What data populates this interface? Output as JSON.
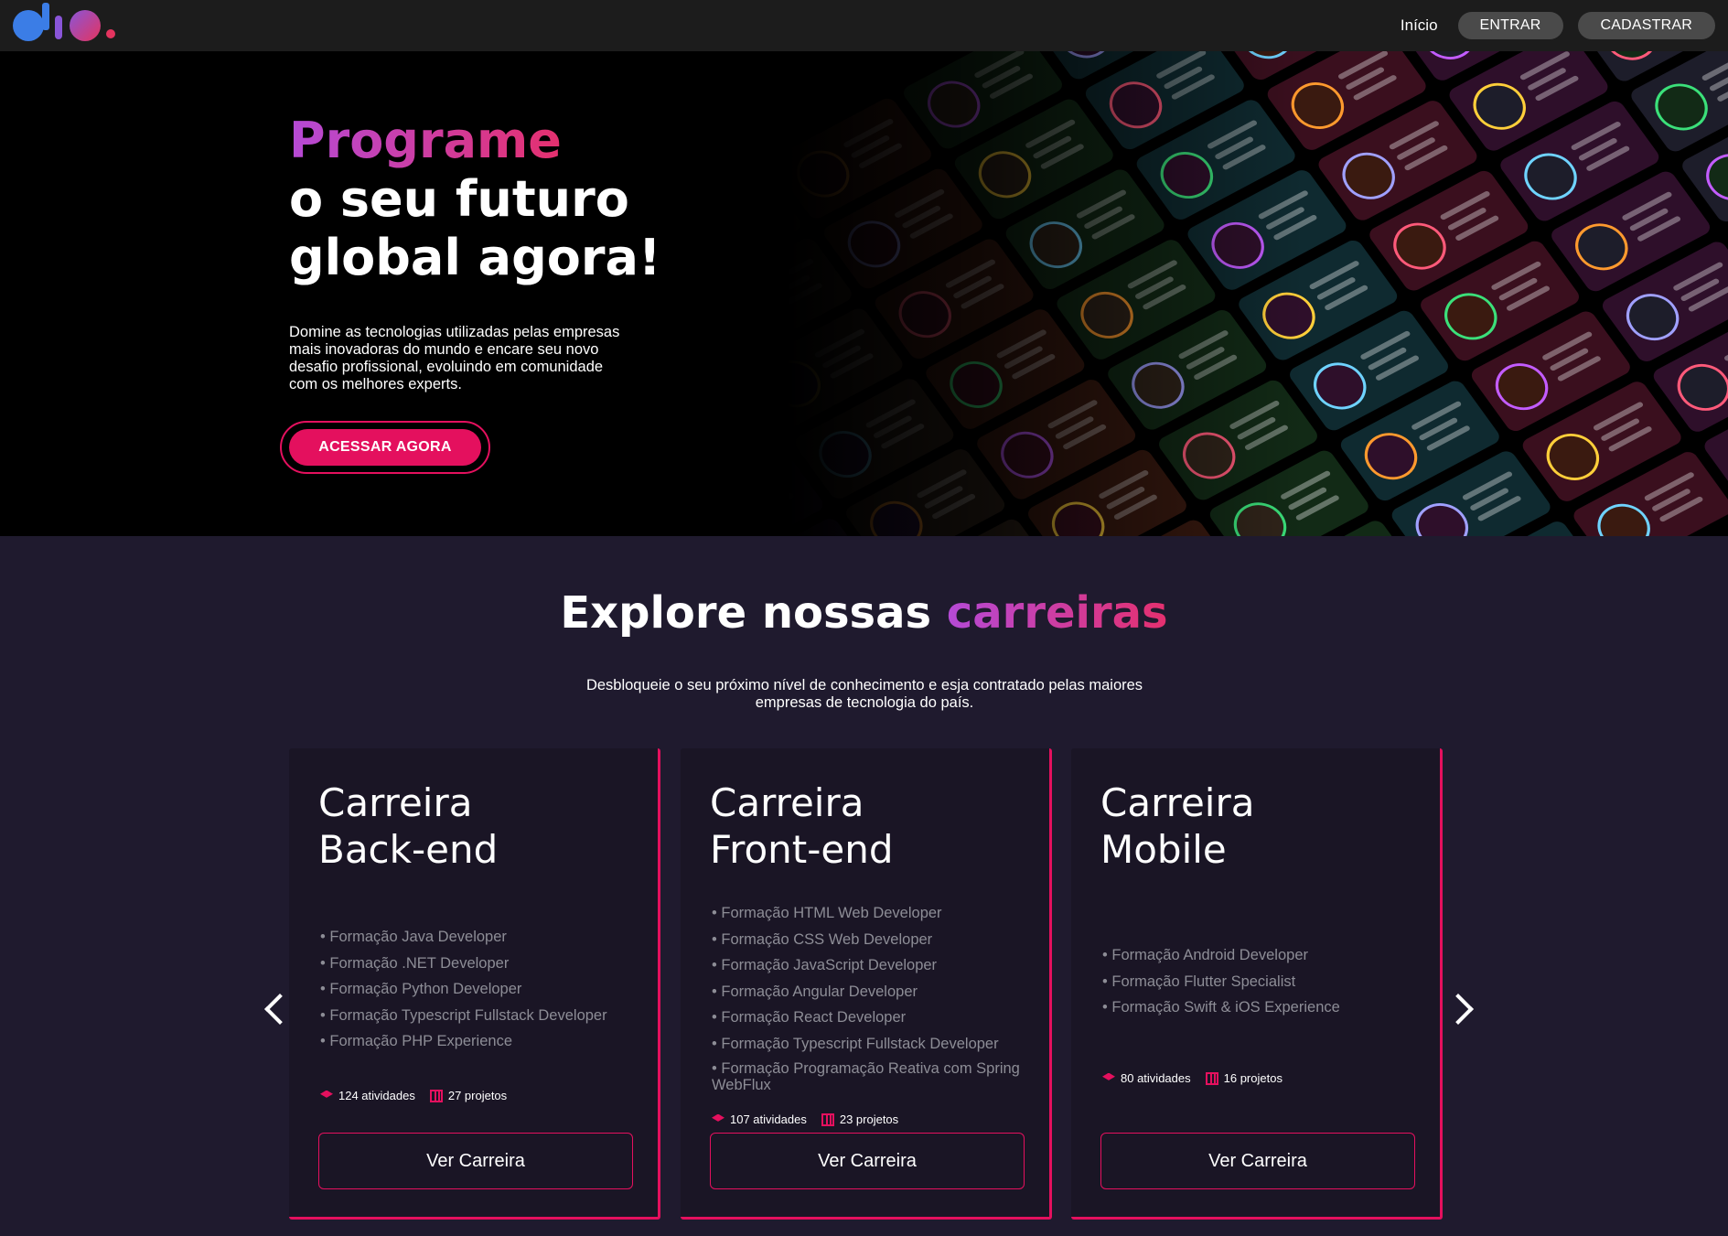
{
  "nav": {
    "home_label": "Início",
    "login_label": "ENTRAR",
    "signup_label": "CADASTRAR"
  },
  "hero": {
    "title_accent": "Programe",
    "title_line2": "o seu futuro",
    "title_line3": "global agora!",
    "description": "Domine as tecnologias utilizadas pelas empresas mais inovadoras do mundo e encare seu novo desafio profissional, evoluindo em comunidade com os melhores experts.",
    "cta_label": "ACESSAR AGORA"
  },
  "careers": {
    "title_main": "Explore nossas ",
    "title_accent": "carreiras",
    "description": "Desbloqueie o seu próximo nível de conhecimento e esja contratado pelas maiores empresas de tecnologia do país.",
    "cards": [
      {
        "title_line1": "Carreira",
        "title_line2": "Back-end",
        "items": [
          "Formação Java Developer",
          "Formação .NET Developer",
          "Formação Python Developer",
          "Formação Typescript Fullstack Developer",
          "Formação PHP Experience"
        ],
        "activities": "124 atividades",
        "projects": "27 projetos",
        "button_label": "Ver Carreira"
      },
      {
        "title_line1": "Carreira",
        "title_line2": "Front-end",
        "items": [
          "Formação HTML Web Developer",
          "Formação CSS Web Developer",
          "Formação JavaScript Developer",
          "Formação Angular Developer",
          "Formação React Developer",
          "Formação Typescript Fullstack Developer",
          "Formação Programação Reativa com Spring WebFlux"
        ],
        "activities": "107 atividades",
        "projects": "23 projetos",
        "button_label": "Ver Carreira"
      },
      {
        "title_line1": "Carreira",
        "title_line2": "Mobile",
        "items": [
          "Formação Android Developer",
          "Formação Flutter Specialist",
          "Formação Swift & iOS Experience"
        ],
        "activities": "80 atividades",
        "projects": "16 projetos",
        "button_label": "Ver Carreira"
      }
    ]
  },
  "colors": {
    "accent": "#e4105e",
    "gradient_start": "#b54ad6",
    "background": "#1f1a2e",
    "card_background": "#1a1525"
  },
  "icons": {
    "prev": "chevron-left-icon",
    "next": "chevron-right-icon",
    "activities": "graduation-cap-icon",
    "projects": "project-board-icon"
  }
}
